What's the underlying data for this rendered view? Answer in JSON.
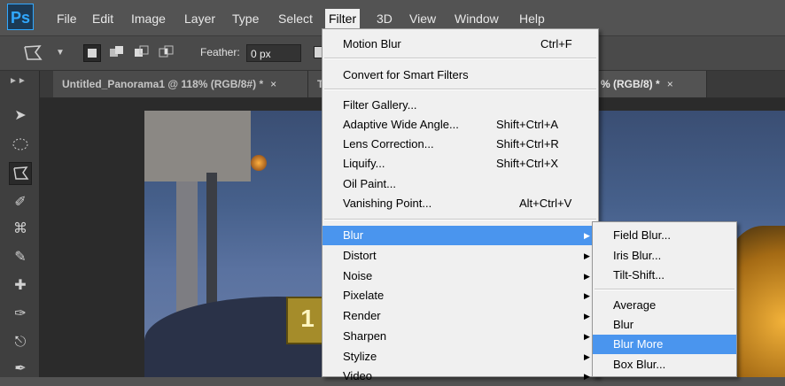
{
  "app": {
    "logo": "Ps"
  },
  "menubar": {
    "items": [
      "File",
      "Edit",
      "Image",
      "Layer",
      "Type",
      "Select",
      "Filter",
      "3D",
      "View",
      "Window",
      "Help"
    ],
    "active": "Filter"
  },
  "options_bar": {
    "feather_label": "Feather:",
    "feather_value": "0 px"
  },
  "tabs": [
    {
      "label": "Untitled_Panorama1 @ 118% (RGB/8#) *",
      "close": "×"
    },
    {
      "label": "T"
    },
    {
      "label": "% (RGB/8) *",
      "close": "×"
    }
  ],
  "canvas": {
    "sign_text": "1"
  },
  "filter_menu": {
    "items": [
      {
        "label": "Motion Blur",
        "shortcut": "Ctrl+F"
      },
      {
        "label": "Convert for Smart Filters"
      },
      {
        "label": "Filter Gallery..."
      },
      {
        "label": "Adaptive Wide Angle...",
        "shortcut": "Shift+Ctrl+A"
      },
      {
        "label": "Lens Correction...",
        "shortcut": "Shift+Ctrl+R"
      },
      {
        "label": "Liquify...",
        "shortcut": "Shift+Ctrl+X"
      },
      {
        "label": "Oil Paint..."
      },
      {
        "label": "Vanishing Point...",
        "shortcut": "Alt+Ctrl+V"
      },
      {
        "label": "Blur",
        "submenu": true,
        "highlighted": true
      },
      {
        "label": "Distort",
        "submenu": true
      },
      {
        "label": "Noise",
        "submenu": true
      },
      {
        "label": "Pixelate",
        "submenu": true
      },
      {
        "label": "Render",
        "submenu": true
      },
      {
        "label": "Sharpen",
        "submenu": true
      },
      {
        "label": "Stylize",
        "submenu": true
      },
      {
        "label": "Video",
        "submenu": true
      }
    ]
  },
  "blur_submenu": {
    "items": [
      {
        "label": "Field Blur..."
      },
      {
        "label": "Iris Blur..."
      },
      {
        "label": "Tilt-Shift..."
      },
      {
        "label": "Average"
      },
      {
        "label": "Blur"
      },
      {
        "label": "Blur More",
        "highlighted": true
      },
      {
        "label": "Box Blur..."
      }
    ]
  },
  "colors": {
    "menu_highlight": "#4a95ee",
    "app_background": "#535353",
    "logo_accent": "#31a8ff"
  }
}
